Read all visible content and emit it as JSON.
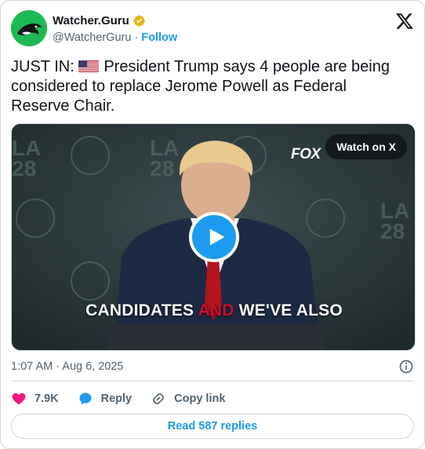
{
  "account": {
    "display_name": "Watcher.Guru",
    "handle": "@WatcherGuru",
    "separator": "·",
    "follow_label": "Follow",
    "verified_color": "#e2b719",
    "avatar_color": "#1db954"
  },
  "tweet": {
    "text_prefix": "JUST IN:",
    "flag_icon": "us-flag-icon",
    "text_body": "President Trump says 4 people are being considered to replace Jerome Powell as Federal Reserve Chair."
  },
  "media": {
    "watch_label": "Watch on X",
    "network_logo": "FOX",
    "caption_part1": "CANDIDATES",
    "caption_part2": "AND",
    "caption_part3": "WE'VE ALSO",
    "play_icon": "play-icon",
    "accent_color": "#1d9bf0"
  },
  "meta": {
    "timestamp": "1:07 AM · Aug 6, 2025",
    "info_icon": "info-icon"
  },
  "actions": {
    "like_count": "7.9K",
    "reply_label": "Reply",
    "copy_link_label": "Copy link"
  },
  "footer": {
    "read_replies_label": "Read 587 replies"
  },
  "colors": {
    "link": "#1d9bf0",
    "heart": "#f91880",
    "text_secondary": "#536471"
  }
}
